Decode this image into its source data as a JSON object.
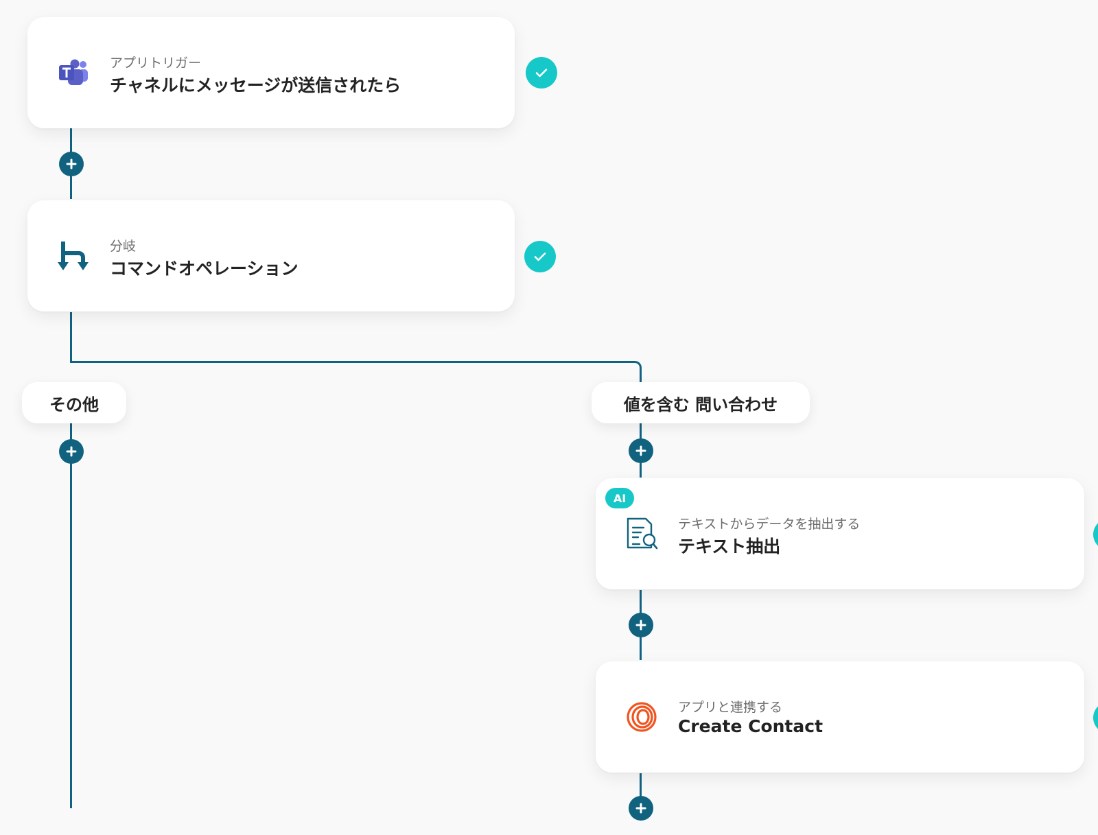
{
  "flow": {
    "steps": [
      {
        "id": "trigger",
        "subtitle": "アプリトリガー",
        "title": "チャネルにメッセージが送信されたら",
        "icon": "teams-icon",
        "status": "complete"
      },
      {
        "id": "branch",
        "subtitle": "分岐",
        "title": "コマンドオペレーション",
        "icon": "branch-icon",
        "status": "complete"
      }
    ],
    "branches": [
      {
        "label": "その他",
        "steps": []
      },
      {
        "label": "値を含む 問い合わせ",
        "steps": [
          {
            "id": "extract",
            "badge": "AI",
            "subtitle": "テキストからデータを抽出する",
            "title": "テキスト抽出",
            "icon": "document-search-icon",
            "status": "complete"
          },
          {
            "id": "create-contact",
            "subtitle": "アプリと連携する",
            "title": "Create Contact",
            "icon": "loops-app-icon",
            "status": "complete"
          }
        ]
      }
    ]
  },
  "colors": {
    "background": "#f9f9f9",
    "connector": "#116281",
    "add_button": "#11627f",
    "status_complete": "#17c8c8",
    "ai_badge": "#17c8c8",
    "teams_purple": "#5b5fc7",
    "brand_orange": "#f0541f"
  }
}
